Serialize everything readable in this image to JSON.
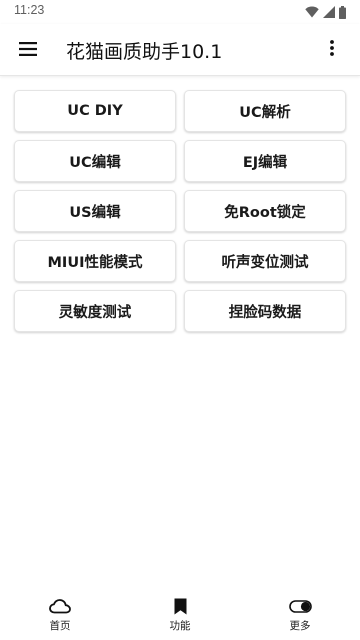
{
  "status_bar": {
    "time": "11:23",
    "icons": [
      "wifi-icon",
      "signal-icon",
      "battery-icon"
    ]
  },
  "app_bar": {
    "title": "花猫画质助手10.1",
    "menu_icon": "hamburger-menu-icon",
    "more_icon": "more-vert-icon"
  },
  "grid": {
    "buttons": [
      {
        "label": "UC DIY"
      },
      {
        "label": "UC解析"
      },
      {
        "label": "UC编辑"
      },
      {
        "label": "EJ编辑"
      },
      {
        "label": "US编辑"
      },
      {
        "label": "免Root锁定"
      },
      {
        "label": "MIUI性能模式"
      },
      {
        "label": "听声变位测试"
      },
      {
        "label": "灵敏度测试"
      },
      {
        "label": "捏脸码数据"
      }
    ]
  },
  "bottom_nav": {
    "items": [
      {
        "label": "首页",
        "icon": "cloud-icon"
      },
      {
        "label": "功能",
        "icon": "bookmark-icon"
      },
      {
        "label": "更多",
        "icon": "toggle-icon"
      }
    ]
  },
  "colors": {
    "background": "#ffffff",
    "text": "#111111",
    "status_text": "#5f5f5f",
    "tile_border": "#e4e4e4"
  }
}
